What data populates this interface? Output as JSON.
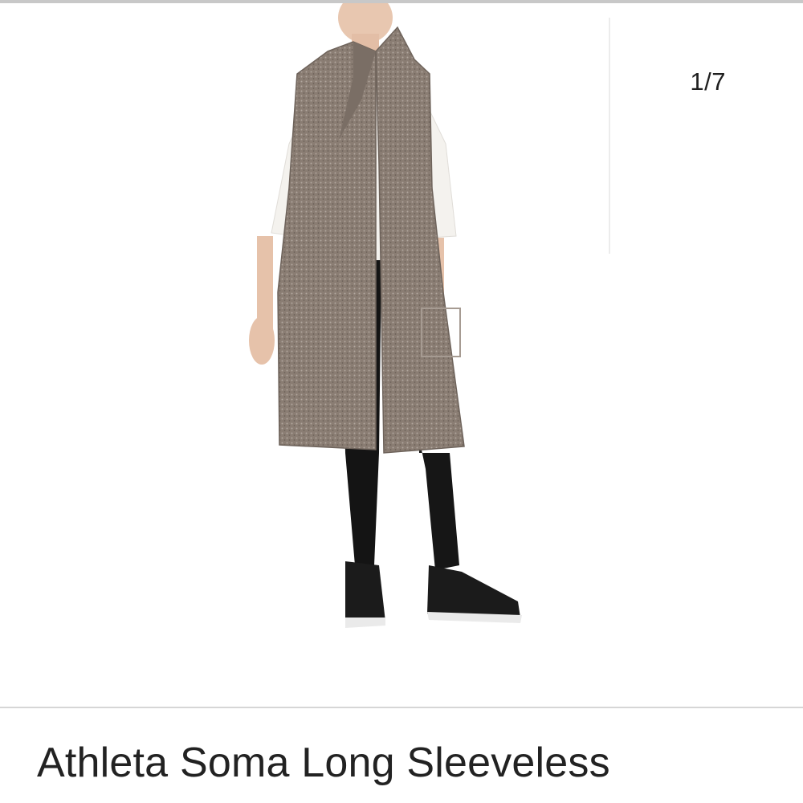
{
  "gallery": {
    "counter": "1/7",
    "photo_subject": "woman-wearing-long-sleeveless-vest",
    "colors": {
      "vest": "#8a7d73",
      "top": "#f4f2ee",
      "leggings": "#141414",
      "shoes": "#1b1b1b"
    }
  },
  "product": {
    "title": "Athleta Soma Long Sleeveless"
  }
}
